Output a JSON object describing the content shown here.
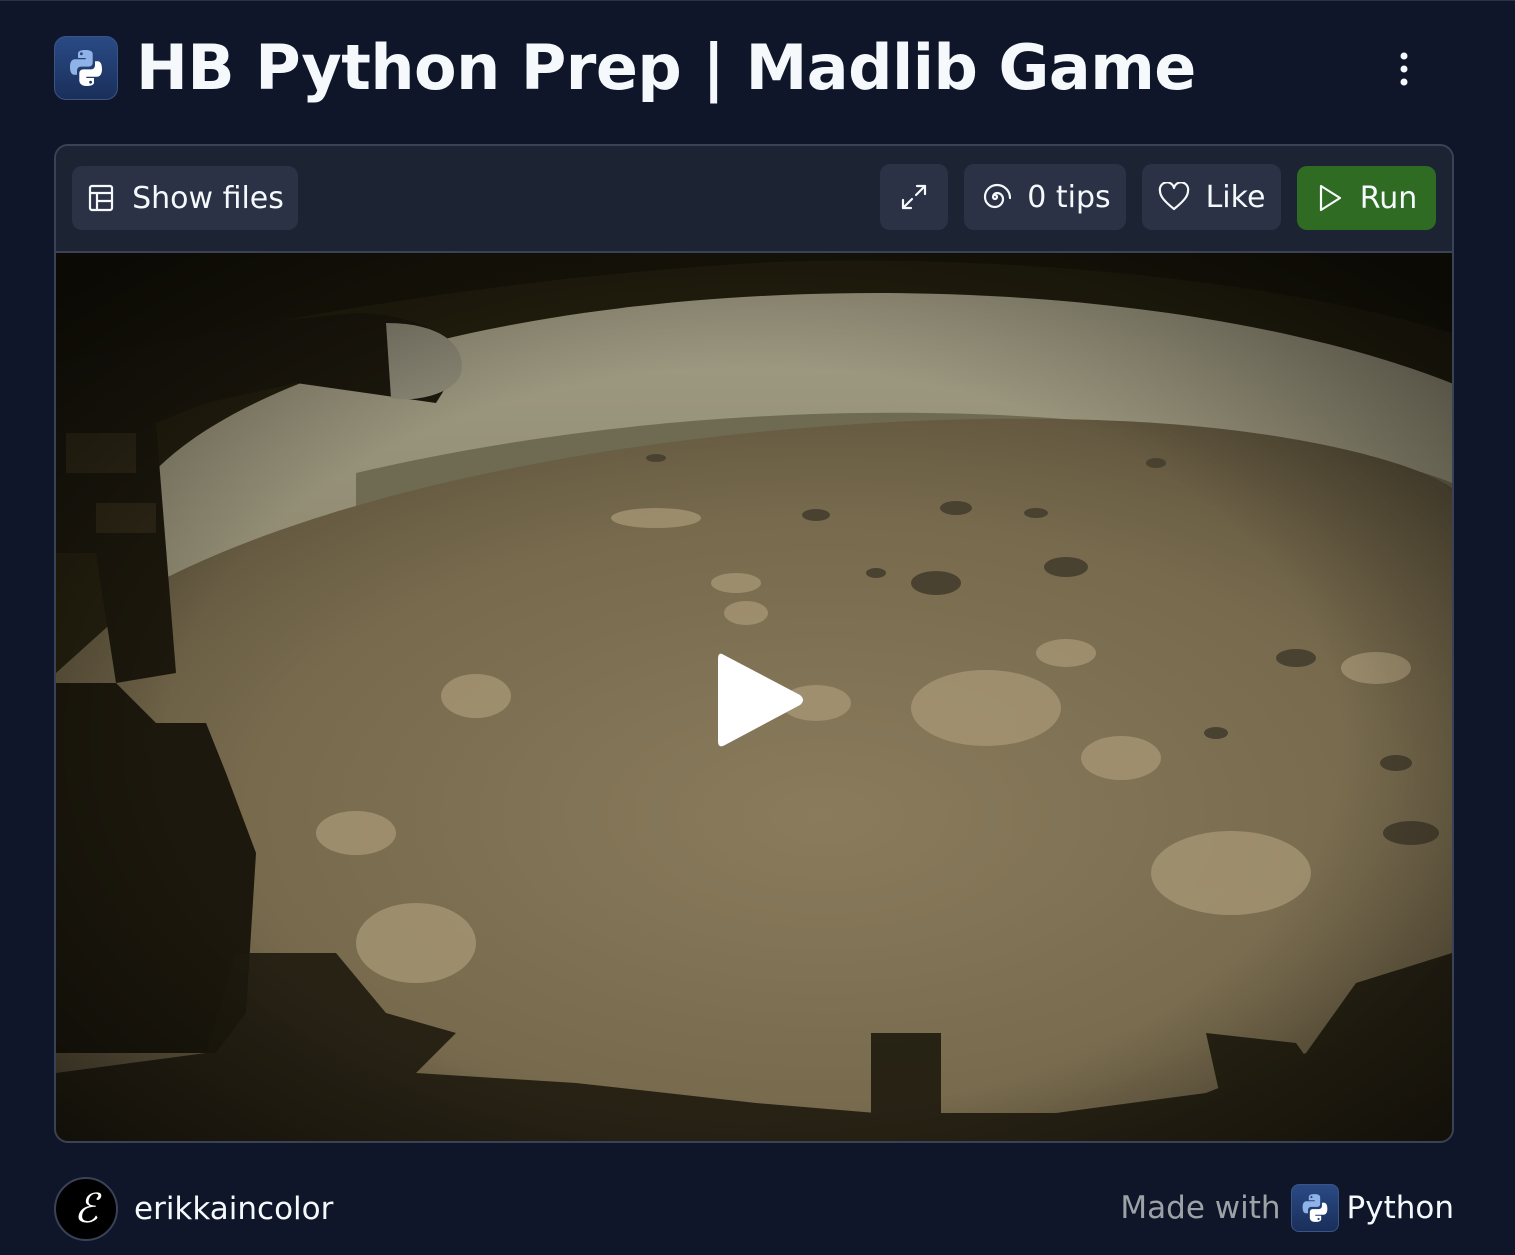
{
  "header": {
    "title": "HB Python Prep | Madlib Game",
    "repl_icon": "python-icon",
    "menu_icon": "kebab-menu-icon"
  },
  "toolbar": {
    "show_files_label": "Show files",
    "show_files_icon": "files-panel-icon",
    "expand_icon": "expand-icon",
    "tips_label": "0 tips",
    "tips_icon": "spiral-icon",
    "like_label": "Like",
    "like_icon": "heart-icon",
    "run_label": "Run",
    "run_icon": "play-outline-icon"
  },
  "preview": {
    "play_icon": "play-icon"
  },
  "footer": {
    "avatar_letter": "ℰ",
    "username": "erikkaincolor",
    "made_with_label": "Made with",
    "language": "Python"
  },
  "colors": {
    "background": "#0f1629",
    "surface": "#1c2333",
    "button": "#2b3245",
    "run_button": "#2f6b22",
    "text": "#f5f9fc",
    "muted_text": "#9da2a6"
  }
}
